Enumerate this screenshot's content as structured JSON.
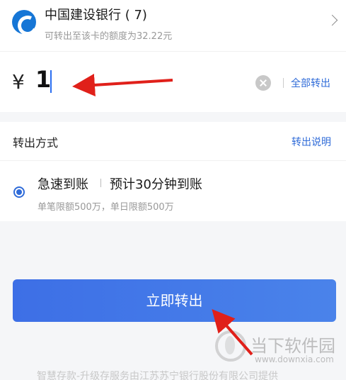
{
  "bank": {
    "name": "中国建设银行 (     7)",
    "limit_text": "可转出至该卡的额度为32.22元",
    "logo_icon": "ccb-logo-icon"
  },
  "amount": {
    "currency": "¥",
    "value": "1",
    "clear_icon": "clear-icon",
    "transfer_all_label": "全部转出"
  },
  "method": {
    "title": "转出方式",
    "help_label": "转出说明",
    "option": {
      "name": "急速到账",
      "eta": "预计30分钟到账",
      "limit": "单笔限额500万，单日限额500万",
      "selected": true
    }
  },
  "submit": {
    "label": "立即转出"
  },
  "footer": {
    "note": "智慧存款-升级存服务由江苏苏宁银行股份有限公司提供"
  },
  "watermark": {
    "name": "当下软件园",
    "url": "www.downxia.com"
  },
  "colors": {
    "accent": "#2f6bd8",
    "button": "#4a7fe8",
    "annotation_arrow": "#e0201a"
  }
}
